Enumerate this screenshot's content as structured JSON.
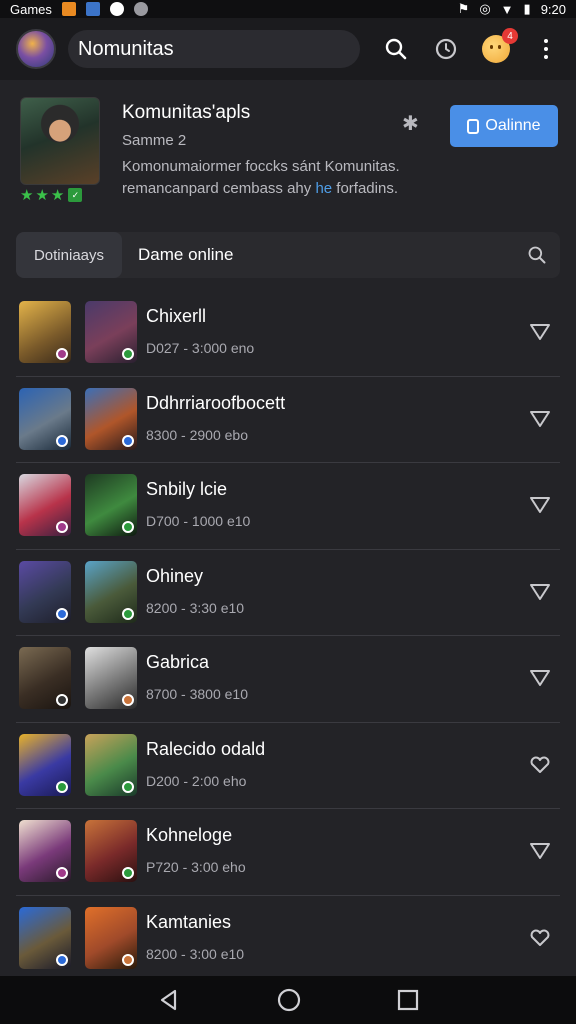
{
  "status_bar": {
    "app_label": "Games",
    "time": "9:20"
  },
  "app_bar": {
    "search_text": "Nomunitas",
    "notification_count": "4"
  },
  "header": {
    "title": "Komunitas'apls",
    "subtitle": "Samme 2",
    "description_line1": "Komonumaiormer foccks sánt Komunitas.",
    "description_line2_a": "remancanpard cembass ahy",
    "description_line2_highlight": "he",
    "description_line2_b": "forfadins.",
    "rating_stars": 3,
    "online_button": "Oalinne",
    "accent_color": "#4a8fe7"
  },
  "filter": {
    "chip_label": "Dotiniaays",
    "label": "Dame online"
  },
  "rows": [
    {
      "title": "Chixerll",
      "meta": "D027  - 3:000  eno"
    },
    {
      "title": "Ddhrria­roofbocett",
      "meta": "8300  - 2900  ebo"
    },
    {
      "title": "Snbily lcie",
      "meta": "D700  - 1000  e10"
    },
    {
      "title": "Ohiney",
      "meta": "8200  - 3:30  e10"
    },
    {
      "title": "Gabrica",
      "meta": "8700  - 3800  e10"
    },
    {
      "title": "Ralecido odald",
      "meta": "D200  - 2:00  eho"
    },
    {
      "title": "Kohneloge",
      "meta": "P720  - 3:00  eho"
    },
    {
      "title": "Kamtanies",
      "meta": "8200  - 3:00  e10"
    }
  ]
}
